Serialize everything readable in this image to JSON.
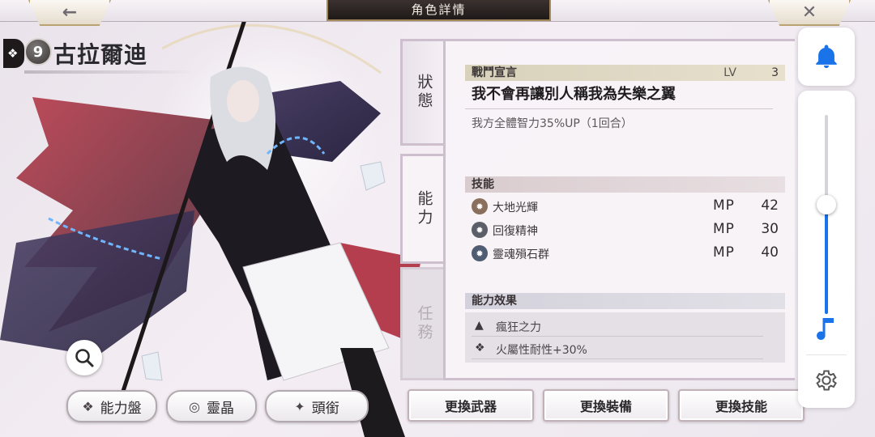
{
  "header": {
    "title": "角色詳情",
    "back_icon": "arrow-left-icon",
    "close_icon": "close-icon"
  },
  "character": {
    "name": "古拉爾迪",
    "level_badge": "9"
  },
  "tabs": [
    {
      "label": "狀態",
      "state": "inactive-side"
    },
    {
      "label": "能力",
      "state": "active"
    },
    {
      "label": "任務",
      "state": "disabled"
    }
  ],
  "battle_declaration": {
    "header": "戰鬥宣言",
    "lv_label": "LV",
    "lv_value": "3",
    "title": "我不會再讓別人稱我為失樂之翼",
    "description": "我方全體智力35%UP（1回合）"
  },
  "skills": {
    "header": "技能",
    "mp_label": "MP",
    "items": [
      {
        "name": "大地光輝",
        "mp": "42",
        "icon_color": "#8a6f5c"
      },
      {
        "name": "回復精神",
        "mp": "30",
        "icon_color": "#5a5f6a"
      },
      {
        "name": "靈魂殞石群",
        "mp": "40",
        "icon_color": "#4f5c72"
      }
    ]
  },
  "ability_effects": {
    "header": "能力效果",
    "items": [
      {
        "text": "瘋狂之力",
        "icon": "person-icon"
      },
      {
        "text": "火屬性耐性+30%",
        "icon": "grid-icon"
      }
    ]
  },
  "left_buttons": {
    "ability_board": "能力盤",
    "crystal": "靈晶",
    "title": "頭銜"
  },
  "action_buttons": {
    "change_weapon": "更換武器",
    "change_equipment": "更換裝備",
    "change_skill": "更換技能"
  },
  "volume_panel": {
    "level_percent": 55,
    "accent_color": "#1a73e8"
  }
}
